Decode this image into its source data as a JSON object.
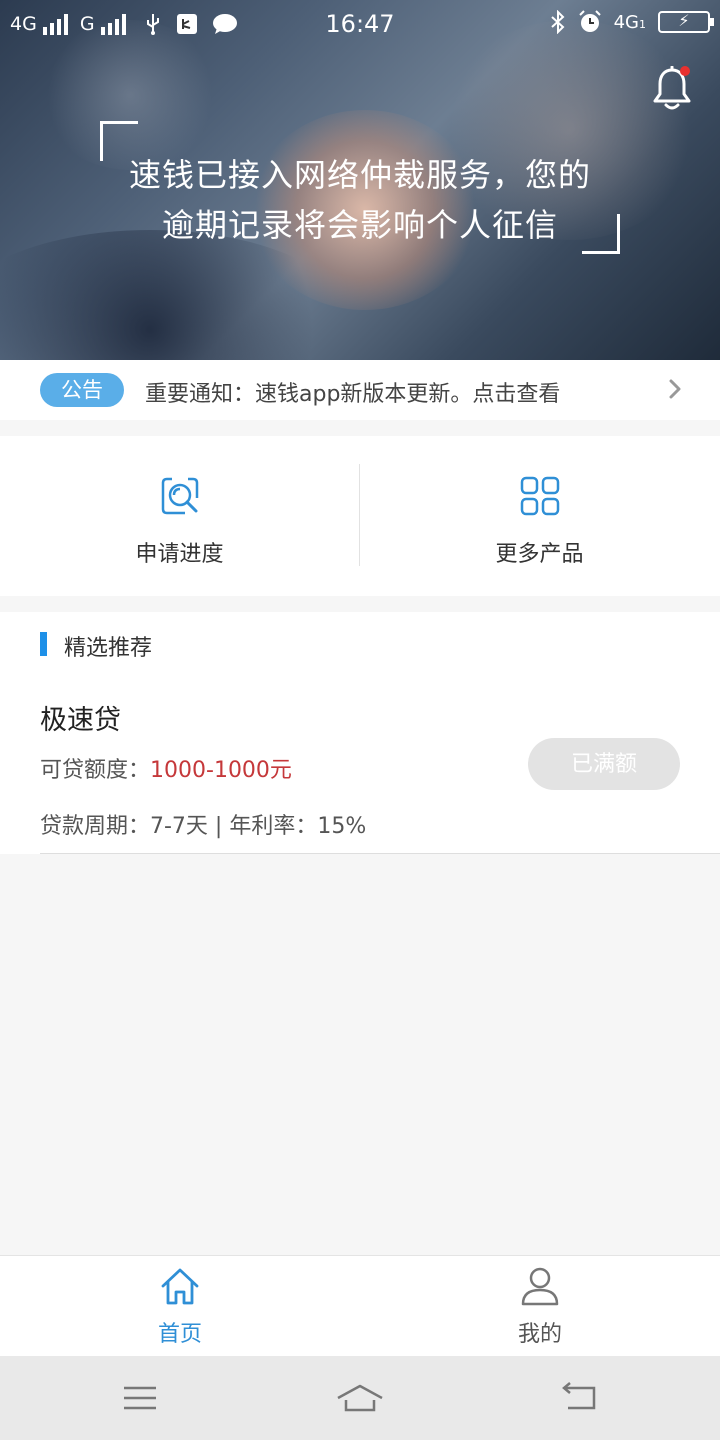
{
  "status_bar": {
    "network_left_1": "4G",
    "network_left_2": "G",
    "time": "16:47",
    "network_right": "4G",
    "network_right_sub": "1"
  },
  "hero": {
    "line1": "速钱已接入网络仲裁服务，您的",
    "line2": "逾期记录将会影响个人征信",
    "has_unread_notification": true
  },
  "notice": {
    "tag": "公告",
    "text": "重要通知：速钱app新版本更新。点击查看"
  },
  "quick_actions": [
    {
      "label": "申请进度",
      "icon": "search-progress-icon"
    },
    {
      "label": "更多产品",
      "icon": "grid-icon"
    }
  ],
  "recommend": {
    "title": "精选推荐",
    "product": {
      "name": "极速贷",
      "limit_label": "可贷额度：",
      "limit_value": "1000-1000元",
      "term_text": "贷款周期：7-7天 | 年利率：15%",
      "button": "已满额"
    }
  },
  "tabbar": {
    "home": "首页",
    "mine": "我的",
    "active": "home"
  },
  "colors": {
    "accent": "#1e90e8",
    "notice_tag": "#5aaee8",
    "amount": "#c5383a",
    "disabled_button": "#e3e3e3"
  }
}
